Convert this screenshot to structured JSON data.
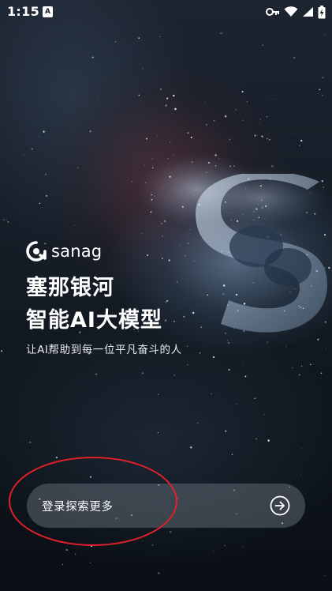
{
  "status_bar": {
    "time": "1:15",
    "notification_icon": "a-icon",
    "key_icon": "vpn-key-icon",
    "wifi_icon": "wifi-icon",
    "signal_icon": "signal-icon",
    "battery_icon": "battery-charging-icon"
  },
  "brand": {
    "logo_icon": "sanag-logo-icon",
    "name": "sanag"
  },
  "headline": {
    "line1": "塞那银河",
    "line2": "智能AI大模型"
  },
  "tagline": "让AI帮助到每一位平凡奋斗的人",
  "login": {
    "label": "登录探索更多",
    "arrow_icon": "arrow-right-circle-icon"
  },
  "colors": {
    "annotation": "#e1202a",
    "text": "#ffffff",
    "login_bar_bg": "rgba(120,128,138,0.42)"
  }
}
